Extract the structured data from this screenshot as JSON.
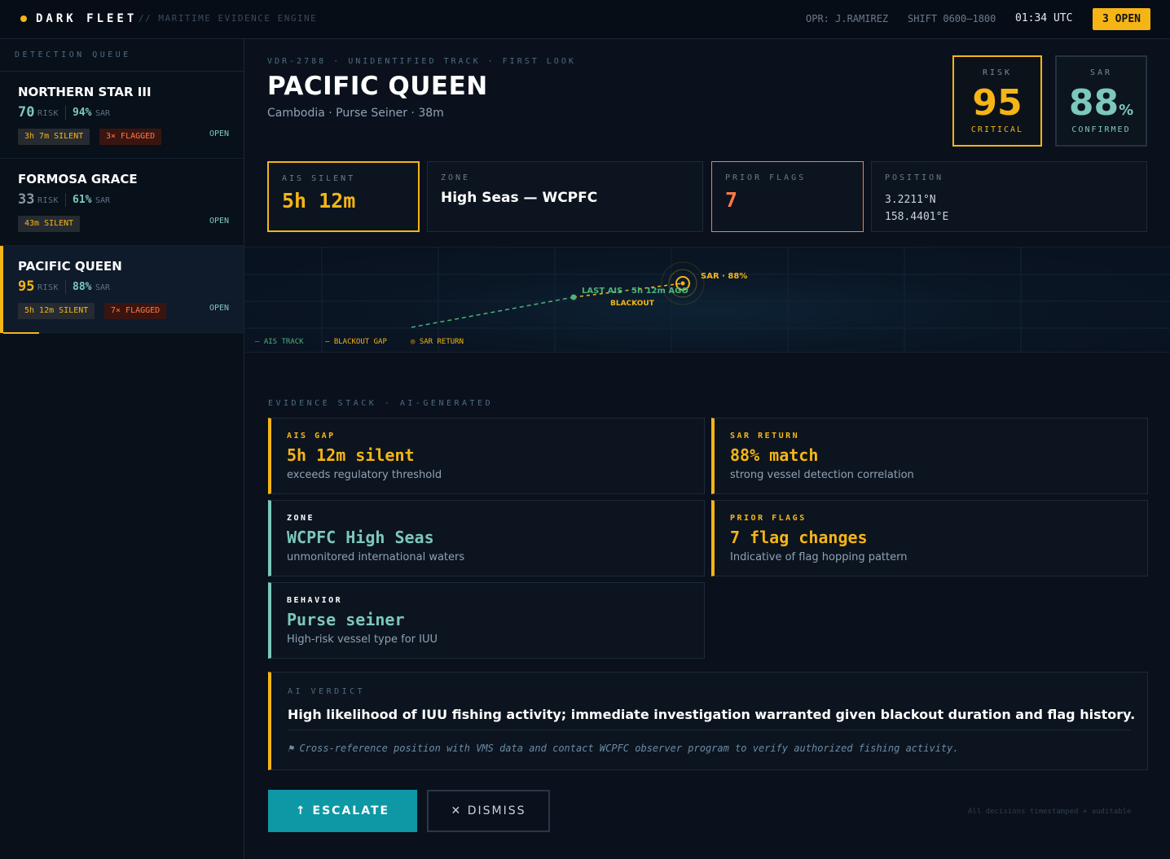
{
  "topbar": {
    "brand": "DARK FLEET",
    "subtitle": "// MARITIME EVIDENCE ENGINE",
    "operator": "OPR: J.RAMIREZ",
    "shift": "SHIFT 0600–1800",
    "time": "01:34 UTC",
    "open_badge": "3 OPEN"
  },
  "sidebar": {
    "title": "DETECTION QUEUE",
    "items": [
      {
        "name": "NORTHERN STAR III",
        "risk": "70",
        "risk_label": "RISK",
        "sar": "94%",
        "sar_label": "SAR",
        "silent": "3h 7m SILENT",
        "flagged": "3× FLAGGED",
        "status": "OPEN"
      },
      {
        "name": "FORMOSA GRACE",
        "risk": "33",
        "risk_label": "RISK",
        "sar": "61%",
        "sar_label": "SAR",
        "silent": "43m SILENT",
        "status": "OPEN"
      },
      {
        "name": "PACIFIC QUEEN",
        "risk": "95",
        "risk_label": "RISK",
        "sar": "88%",
        "sar_label": "SAR",
        "silent": "5h 12m SILENT",
        "flagged": "7× FLAGGED",
        "status": "OPEN"
      }
    ]
  },
  "case": {
    "id_line": "VDR-2788 · UNIDENTIFIED TRACK · FIRST LOOK",
    "name": "PACIFIC QUEEN",
    "subtitle": "Cambodia · Purse Seiner · 38m",
    "risk": {
      "label": "RISK",
      "value": "95",
      "foot": "CRITICAL"
    },
    "sar": {
      "label": "SAR",
      "value": "88",
      "unit": "%",
      "foot": "CONFIRMED"
    }
  },
  "stats": {
    "ais": {
      "label": "AIS SILENT",
      "value": "5h 12m"
    },
    "zone": {
      "label": "ZONE",
      "value": "High Seas — WCPFC"
    },
    "flags": {
      "label": "PRIOR FLAGS",
      "value": "7"
    },
    "position": {
      "label": "POSITION",
      "lat": "3.2211°N",
      "lon": "158.4401°E"
    }
  },
  "map": {
    "last_ais": "LAST AIS · 5h 12m AGO",
    "blackout": "BLACKOUT",
    "sar_label": "SAR · 88%",
    "legend_track": "— AIS TRACK",
    "legend_gap": "– BLACKOUT GAP",
    "legend_sar": "◎ SAR RETURN"
  },
  "evidence": {
    "title": "EVIDENCE STACK · AI-GENERATED",
    "cards": [
      {
        "title": "AIS GAP",
        "value": "5h 12m silent",
        "desc": "exceeds regulatory threshold"
      },
      {
        "title": "SAR RETURN",
        "value": "88% match",
        "desc": "strong vessel detection correlation"
      },
      {
        "title": "ZONE",
        "value": "WCPFC High Seas",
        "desc": "unmonitored international waters"
      },
      {
        "title": "PRIOR FLAGS",
        "value": "7 flag changes",
        "desc": "Indicative of flag hopping pattern"
      },
      {
        "title": "BEHAVIOR",
        "value": "Purse seiner",
        "desc": "High-risk vessel type for IUU"
      }
    ]
  },
  "verdict": {
    "label": "AI VERDICT",
    "text": "High likelihood of IUU fishing activity; immediate investigation warranted given blackout duration and flag history.",
    "recommendation": "⚑ Cross-reference position with VMS data and contact WCPFC observer program to verify authorized fishing activity."
  },
  "actions": {
    "escalate": "↑ ESCALATE",
    "dismiss": "✕ DISMISS",
    "footnote": "All decisions timestamped + auditable"
  },
  "colors": {
    "accent": "#f5b516",
    "teal": "#7cc8bd",
    "alert": "#ff7a45",
    "action": "#0e98a5"
  }
}
